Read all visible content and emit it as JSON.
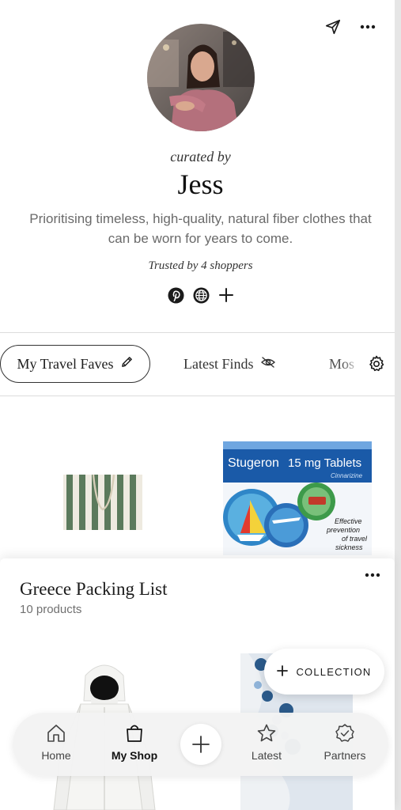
{
  "profile": {
    "curated_label": "curated by",
    "name": "Jess",
    "bio": "Prioritising timeless, high-quality, natural fiber clothes that can be worn for years to come.",
    "trusted": "Trusted by 4 shoppers"
  },
  "tabs": {
    "active": "My Travel Faves",
    "latest": "Latest Finds",
    "partial": "Mos"
  },
  "products": {
    "box_brand": "Stugeron",
    "box_title": "15 mg Tablets",
    "box_ingredient": "Cinnarizine",
    "box_claim": "Effective prevention of travel sickness"
  },
  "collection": {
    "title": "Greece Packing List",
    "count": "10 products",
    "fab_label": "COLLECTION"
  },
  "nav": {
    "home": "Home",
    "shop": "My Shop",
    "latest": "Latest",
    "partners": "Partners"
  },
  "colors": {
    "accent": "#1b1b1b",
    "muted": "#6a6a6a",
    "nav_bg": "#f3f3f3"
  }
}
